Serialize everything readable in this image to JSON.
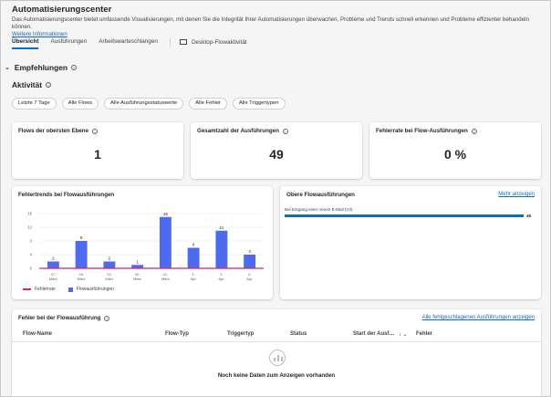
{
  "header": {
    "title": "Automatisierungscenter",
    "description": "Das Automatisierungscenter bietet umfassende Visualisierungen, mit denen Sie die Integrität Ihrer Automatisierungen überwachen, Probleme und Trends schnell erkennen und Probleme effizienter behandeln können.",
    "learn_more": "Weitere Informationen"
  },
  "tabs": [
    {
      "label": "Übersicht",
      "active": true
    },
    {
      "label": "Ausführungen"
    },
    {
      "label": "Arbeitswarteschlangen"
    },
    {
      "label": "Desktop-Flowaktivität"
    }
  ],
  "recommendations": {
    "label": "Empfehlungen"
  },
  "activity": {
    "label": "Aktivität"
  },
  "filters": [
    "Letzte 7 Tage",
    "Alle Flows",
    "Alle Ausführungsstatuswerte",
    "Alle Fehler",
    "Alle Triggertypen"
  ],
  "kpis": [
    {
      "title": "Flows der obersten Ebene",
      "value": "1"
    },
    {
      "title": "Gesamtzahl der Ausführungen",
      "value": "49"
    },
    {
      "title": "Fehlerrate bei Flow-Ausführungen",
      "value": "0 %"
    }
  ],
  "error_trend_card": {
    "title": "Fehlertrends bei Flowausführungen"
  },
  "chart_data": {
    "type": "bar",
    "title": "Fehlertrends bei Flowausführungen",
    "categories": [
      "27. März",
      "28. März",
      "29. März",
      "30. März",
      "31. März",
      "1. Apr.",
      "2. Apr.",
      "3. Apr."
    ],
    "category_lines": [
      [
        "27.",
        "März"
      ],
      [
        "28.",
        "März"
      ],
      [
        "29.",
        "März"
      ],
      [
        "30.",
        "März"
      ],
      [
        "31.",
        "März"
      ],
      [
        "1.",
        "Apr."
      ],
      [
        "2.",
        "Apr."
      ],
      [
        "3.",
        "Apr."
      ]
    ],
    "series": [
      {
        "name": "Flowausführungen",
        "type": "bar",
        "color": "#4f6bed",
        "values": [
          2,
          8,
          2,
          1,
          15,
          6,
          11,
          4
        ]
      },
      {
        "name": "Fehlerrate",
        "type": "line",
        "color": "#d61f78",
        "values": [
          0,
          0,
          0,
          0,
          0,
          0,
          0,
          0
        ]
      }
    ],
    "yticks": [
      0,
      4,
      8,
      12,
      16
    ],
    "ylim": [
      0,
      16
    ],
    "legend": "bottom-left"
  },
  "top_flows_card": {
    "title": "Obere Flowausführungen",
    "link": "Mehr anzeigen",
    "items": [
      {
        "label": "Bei Eingang einer neuen E-Mail (V3)",
        "value": 49,
        "fraction": 1.0,
        "value_label": "49"
      }
    ]
  },
  "errors_card": {
    "title": "Fehler bei der Flowausführung",
    "link": "Alle fehlgeschlagenen Ausführungen anzeigen",
    "columns": [
      "Flow-Name",
      "Flow-Typ",
      "Triggertyp",
      "Status",
      "Start der Ausf…",
      "Fehler"
    ],
    "empty_text": "Noch keine Daten zum Anzeigen vorhanden"
  },
  "colors": {
    "accent": "#0f6cbd",
    "bar": "#4f6bed",
    "error_line": "#d61f78"
  }
}
